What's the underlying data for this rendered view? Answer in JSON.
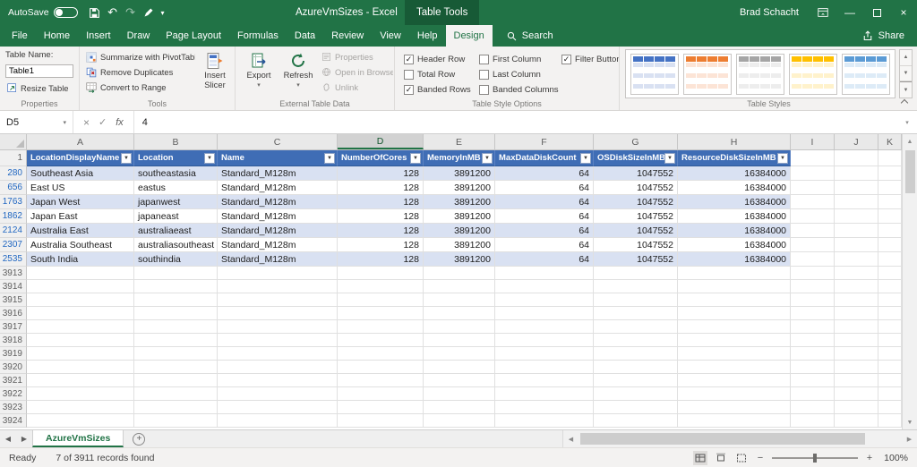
{
  "colors": {
    "excel_green": "#217346",
    "table_header_blue": "#3F6DB5",
    "banded_row_blue": "#D9E1F2",
    "filtered_row_number_blue": "#2268C2"
  },
  "icons": {
    "undo": "↶",
    "redo": "↷",
    "menu_arrow": "▾",
    "filter_arrow": "▼",
    "cancel": "×",
    "enter": "✓",
    "minimize": "—",
    "close": "×",
    "nav_left": "◀",
    "nav_right": "▶",
    "scroll_up": "▲",
    "scroll_down": "▼",
    "add": "+",
    "zoom_out": "−",
    "zoom_in": "+"
  },
  "title_bar": {
    "autosave_label": "AutoSave",
    "autosave_state": "off",
    "title": "AzureVmSizes - Excel",
    "context_group": "Table Tools",
    "user": "Brad Schacht"
  },
  "tabs": {
    "items": [
      "File",
      "Home",
      "Insert",
      "Draw",
      "Page Layout",
      "Formulas",
      "Data",
      "Review",
      "View",
      "Help",
      "Design"
    ],
    "active": "Design",
    "search_label": "Search",
    "share_label": "Share"
  },
  "ribbon": {
    "properties": {
      "table_name_label": "Table Name:",
      "table_name_value": "Table1",
      "resize_table_label": "Resize Table",
      "group_label": "Properties"
    },
    "tools": {
      "summarize_label": "Summarize with PivotTable",
      "remove_duplicates_label": "Remove Duplicates",
      "convert_label": "Convert to Range",
      "insert_slicer_line1": "Insert",
      "insert_slicer_line2": "Slicer",
      "group_label": "Tools"
    },
    "external": {
      "export_label": "Export",
      "refresh_label": "Refresh",
      "properties_label": "Properties",
      "open_browser_label": "Open in Browser",
      "unlink_label": "Unlink",
      "group_label": "External Table Data"
    },
    "style_options": {
      "header_row": {
        "label": "Header Row",
        "checked": true
      },
      "total_row": {
        "label": "Total Row",
        "checked": false
      },
      "banded_rows": {
        "label": "Banded Rows",
        "checked": true
      },
      "first_column": {
        "label": "First Column",
        "checked": false
      },
      "last_column": {
        "label": "Last Column",
        "checked": false
      },
      "banded_columns": {
        "label": "Banded Columns",
        "checked": false
      },
      "filter_button": {
        "label": "Filter Button",
        "checked": true
      },
      "group_label": "Table Style Options"
    },
    "table_styles": {
      "group_label": "Table Styles",
      "swatches": [
        {
          "name": "blue",
          "header": "#4472C4",
          "stripe": "#D9E1F2"
        },
        {
          "name": "orange",
          "header": "#ED7D31",
          "stripe": "#FCE4D6"
        },
        {
          "name": "gray",
          "header": "#A5A5A5",
          "stripe": "#EDEDED"
        },
        {
          "name": "yellow",
          "header": "#FFC000",
          "stripe": "#FFF2CC"
        },
        {
          "name": "light-blue",
          "header": "#5B9BD5",
          "stripe": "#DDEBF7"
        }
      ]
    }
  },
  "formula_bar": {
    "name_box": "D5",
    "fx": "fx",
    "formula": "4"
  },
  "grid": {
    "column_letters": [
      "A",
      "B",
      "C",
      "D",
      "E",
      "F",
      "G",
      "H",
      "I",
      "J",
      "K"
    ],
    "selected_column": "D",
    "table_header": {
      "row_number": "1",
      "cells": [
        "LocationDisplayName",
        "Location",
        "Name",
        "NumberOfCores",
        "MemoryInMB",
        "MaxDataDiskCount",
        "OSDiskSizeInMB",
        "ResourceDiskSizeInMB"
      ]
    },
    "data_rows": [
      {
        "n": "280",
        "cells": [
          "Southeast Asia",
          "southeastasia",
          "Standard_M128m",
          "128",
          "3891200",
          "64",
          "1047552",
          "16384000"
        ]
      },
      {
        "n": "656",
        "cells": [
          "East US",
          "eastus",
          "Standard_M128m",
          "128",
          "3891200",
          "64",
          "1047552",
          "16384000"
        ]
      },
      {
        "n": "1763",
        "cells": [
          "Japan West",
          "japanwest",
          "Standard_M128m",
          "128",
          "3891200",
          "64",
          "1047552",
          "16384000"
        ]
      },
      {
        "n": "1862",
        "cells": [
          "Japan East",
          "japaneast",
          "Standard_M128m",
          "128",
          "3891200",
          "64",
          "1047552",
          "16384000"
        ]
      },
      {
        "n": "2124",
        "cells": [
          "Australia East",
          "australiaeast",
          "Standard_M128m",
          "128",
          "3891200",
          "64",
          "1047552",
          "16384000"
        ]
      },
      {
        "n": "2307",
        "cells": [
          "Australia Southeast",
          "australiasoutheast",
          "Standard_M128m",
          "128",
          "3891200",
          "64",
          "1047552",
          "16384000"
        ]
      },
      {
        "n": "2535",
        "cells": [
          "South India",
          "southindia",
          "Standard_M128m",
          "128",
          "3891200",
          "64",
          "1047552",
          "16384000"
        ]
      }
    ],
    "empty_rows": [
      "3913",
      "3914",
      "3915",
      "3916",
      "3917",
      "3918",
      "3919",
      "3920",
      "3921",
      "3922",
      "3923",
      "3924"
    ]
  },
  "sheet_bar": {
    "tab": "AzureVmSizes"
  },
  "status_bar": {
    "mode": "Ready",
    "records": "7 of 3911 records found",
    "zoom_level": "100%"
  }
}
